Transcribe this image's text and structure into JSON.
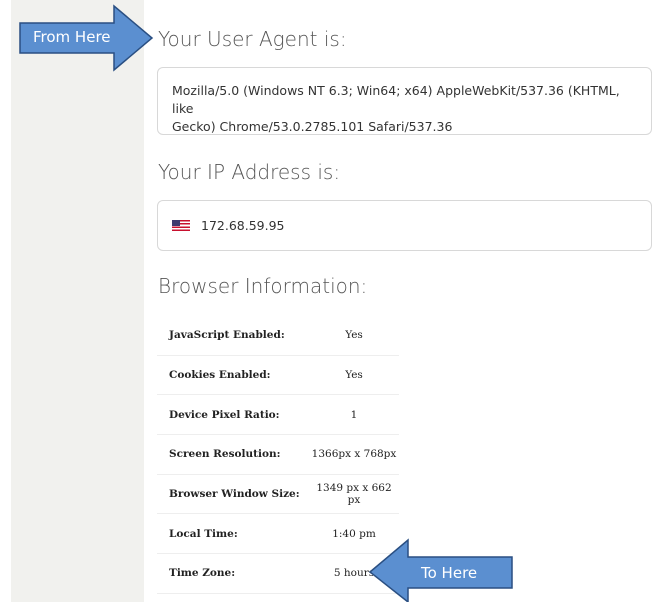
{
  "user_agent": {
    "heading": "Your User Agent is:",
    "line1": "Mozilla/5.0 (Windows NT 6.3; Win64; x64) AppleWebKit/537.36 (KHTML, like",
    "line2": "Gecko) Chrome/53.0.2785.101 Safari/537.36"
  },
  "ip_address": {
    "heading": "Your IP Address is:",
    "flag_icon": "us-flag-icon",
    "value": "172.68.59.95"
  },
  "browser_info": {
    "heading": "Browser Information:",
    "rows": [
      {
        "label": "JavaScript Enabled:",
        "value": "Yes"
      },
      {
        "label": "Cookies Enabled:",
        "value": "Yes"
      },
      {
        "label": "Device Pixel Ratio:",
        "value": "1"
      },
      {
        "label": "Screen Resolution:",
        "value": "1366px x 768px"
      },
      {
        "label": "Browser Window Size:",
        "value": "1349 px x 662 px"
      },
      {
        "label": "Local Time:",
        "value": "1:40 pm"
      },
      {
        "label": "Time Zone:",
        "value": "5 hours"
      }
    ]
  },
  "annotations": {
    "from_label": "From Here",
    "to_label": "To Here",
    "arrow_fill": "#5b8fd0",
    "arrow_stroke": "#2a4f82"
  },
  "colors": {
    "sidebar": "#f1f1ee",
    "heading_text": "#555555",
    "border": "#d8d8d8"
  }
}
